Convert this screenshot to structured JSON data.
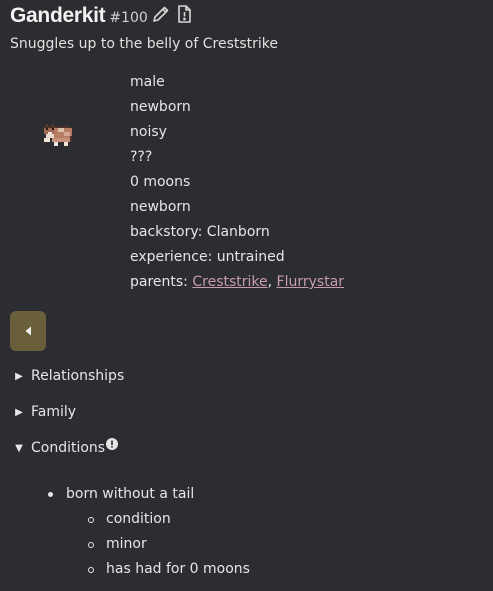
{
  "header": {
    "name": "Ganderkit",
    "id": "#100",
    "edit_icon": "pencil-icon",
    "report_icon": "document-alert-icon"
  },
  "subtitle": "Snuggles up to the belly of Creststrike",
  "info": {
    "sex": "male",
    "status": "newborn",
    "trait": "noisy",
    "skill": "???",
    "age_moons": "0 moons",
    "age_stage": "newborn",
    "backstory": "backstory: Clanborn",
    "experience": "experience: untrained",
    "parents_label": "parents: ",
    "parents": [
      "Creststrike",
      "Flurrystar"
    ],
    "parents_separator": ", "
  },
  "back_button": {
    "icon": "triangle-left-icon"
  },
  "sections": {
    "relationships": {
      "label": "Relationships",
      "expanded": false
    },
    "family": {
      "label": "Family",
      "expanded": false
    },
    "conditions": {
      "label": "Conditions",
      "expanded": true,
      "badge_icon": "info-circle-icon",
      "items": [
        {
          "name": "born without a tail",
          "details": [
            "condition",
            "minor",
            "has had for 0 moons"
          ]
        }
      ]
    }
  },
  "colors": {
    "background": "#2b2d30",
    "text": "#e6e6e6",
    "link": "#c79bb3",
    "back_button": "#6a5f3b"
  }
}
